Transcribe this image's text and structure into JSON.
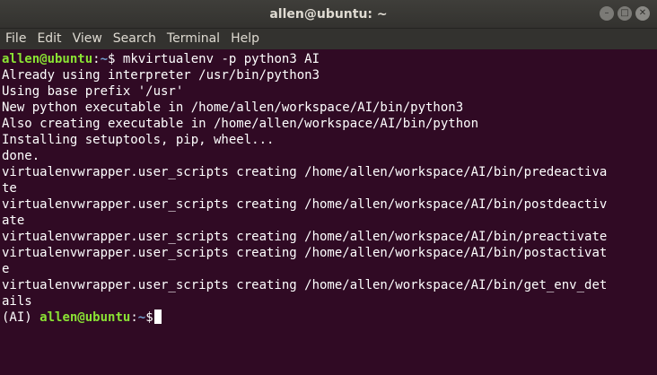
{
  "window": {
    "title": "allen@ubuntu: ~",
    "controls": [
      "minimize",
      "maximize",
      "close"
    ]
  },
  "menu": [
    "File",
    "Edit",
    "View",
    "Search",
    "Terminal",
    "Help"
  ],
  "terminal": {
    "prompt1": {
      "user": "allen@ubuntu",
      "sep": ":",
      "path": "~",
      "symbol": "$",
      "command": " mkvirtualenv -p python3 AI"
    },
    "output": [
      "Already using interpreter /usr/bin/python3",
      "Using base prefix '/usr'",
      "New python executable in /home/allen/workspace/AI/bin/python3",
      "Also creating executable in /home/allen/workspace/AI/bin/python",
      "Installing setuptools, pip, wheel...",
      "done.",
      "virtualenvwrapper.user_scripts creating /home/allen/workspace/AI/bin/predeactiva",
      "te",
      "virtualenvwrapper.user_scripts creating /home/allen/workspace/AI/bin/postdeactiv",
      "ate",
      "virtualenvwrapper.user_scripts creating /home/allen/workspace/AI/bin/preactivate",
      "virtualenvwrapper.user_scripts creating /home/allen/workspace/AI/bin/postactivat",
      "e",
      "virtualenvwrapper.user_scripts creating /home/allen/workspace/AI/bin/get_env_det",
      "ails"
    ],
    "prompt2": {
      "env": "(AI) ",
      "user": "allen@ubuntu",
      "sep": ":",
      "path": "~",
      "symbol": "$"
    }
  },
  "colors": {
    "background": "#300a24",
    "user": "#8ae234",
    "path": "#729fcf",
    "text": "#ffffff"
  }
}
